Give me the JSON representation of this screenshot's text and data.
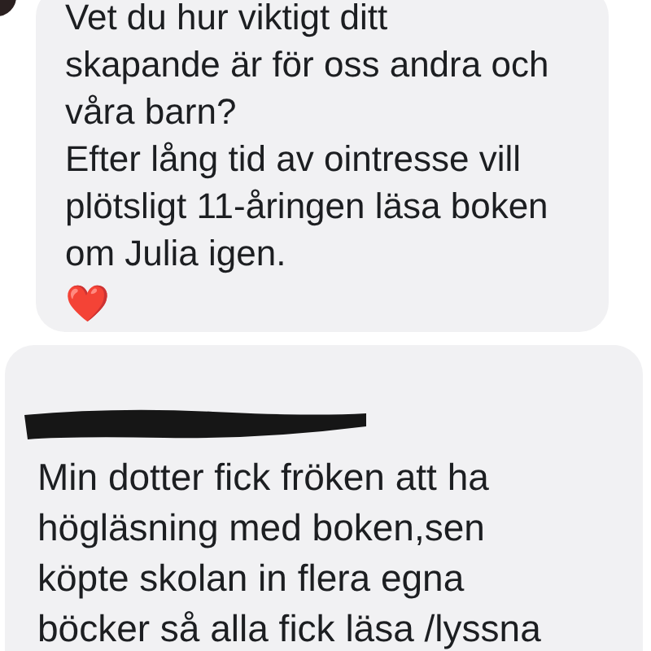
{
  "messages": [
    {
      "paragraphs": [
        "Vet du hur viktigt ditt\nskapande är för oss andra och\nvåra barn?",
        "Efter lång tid av ointresse vill\nplötsligt 11-åringen läsa boken\nom Julia igen."
      ],
      "reaction": "❤️"
    },
    {
      "author": {
        "kind": "redacted"
      },
      "paragraphs": [
        "Min dotter fick fröken att ha\nhögläsning med boken,sen\nköpte skolan in flera egna\nböcker så alla fick läsa /lyssna"
      ]
    }
  ]
}
